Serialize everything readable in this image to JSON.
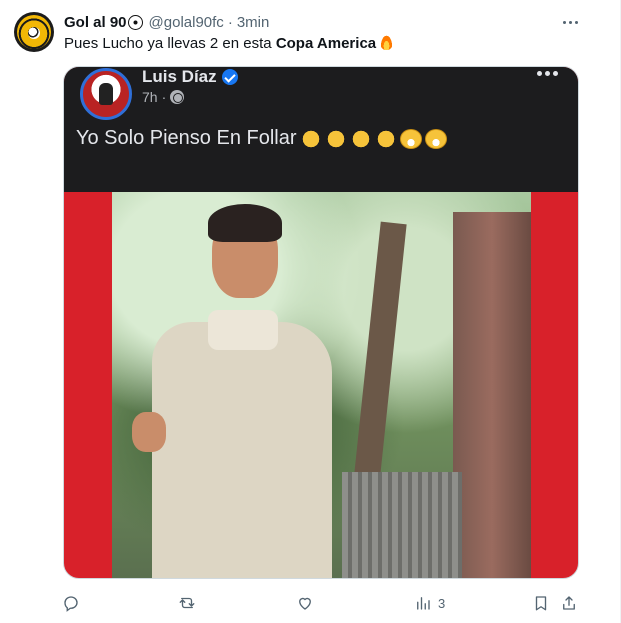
{
  "author": {
    "name": "Gol al 90",
    "handle": "@golal90fc",
    "separator": "·",
    "time": "3min",
    "avatar_icon": "gol-al-90-logo"
  },
  "tweet": {
    "text_before": "Pues Lucho ya llevas 2 en esta ",
    "text_bold": "Copa America",
    "emoji": "fire-emoji"
  },
  "embedded_post": {
    "name": "Luis Díaz",
    "time": "7h",
    "meta_separator": "·",
    "text": "Yo Solo Pienso En Follar",
    "emojis": [
      "pointing-hand",
      "ok-hand",
      "pointing-hand",
      "ok-hand",
      "grin",
      "grin"
    ]
  },
  "actions": {
    "reply_count": "",
    "retweet_count": "",
    "like_count": "",
    "views_count": "3"
  },
  "colors": {
    "text": "#0f1419",
    "secondary": "#536471",
    "fb_bg": "#1c1c1e",
    "red_frame": "#d8212a"
  }
}
